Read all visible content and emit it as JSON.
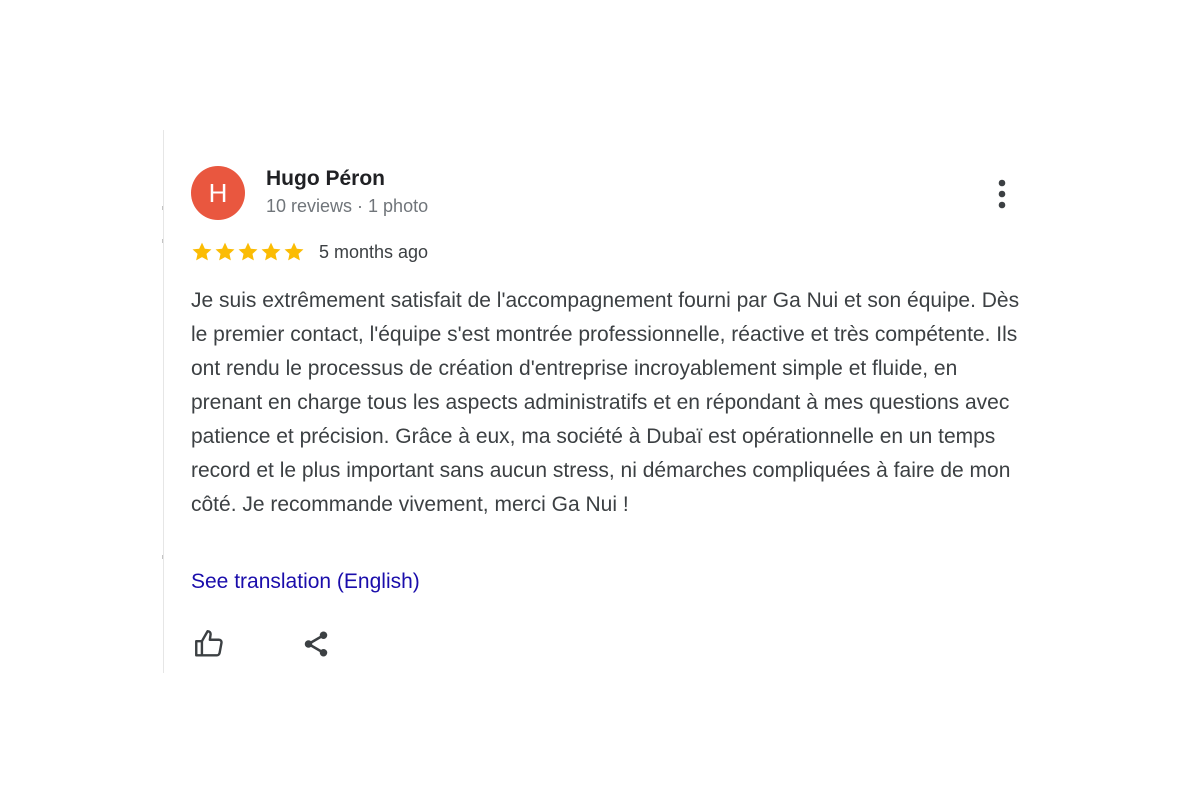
{
  "review": {
    "author": {
      "initial": "H",
      "name": "Hugo Péron",
      "meta": "10 reviews · 1 photo",
      "avatar_color": "#e9573f"
    },
    "rating": {
      "stars": 5,
      "max": 5,
      "star_color": "#fbbc04"
    },
    "time_ago": "5 months ago",
    "text": "Je suis extrêmement satisfait de l'accompagnement fourni par Ga Nui et son équipe. Dès le premier contact, l'équipe s'est montrée professionnelle, réactive et très compétente. Ils ont rendu le processus de création d'entreprise incroyablement simple et fluide, en prenant en charge tous les aspects administratifs et en répondant à mes questions avec patience et précision. Grâce à eux, ma société à Dubaï est opérationnelle en un temps record et le plus important sans aucun stress, ni démarches compliquées à faire de mon côté. Je recommande vivement, merci Ga Nui !",
    "translation_link": "See translation (English)",
    "link_color": "#1a0dab"
  },
  "icons": {
    "more": "more-vertical-icon",
    "like": "thumbs-up-icon",
    "share": "share-icon",
    "star": "star-icon"
  }
}
